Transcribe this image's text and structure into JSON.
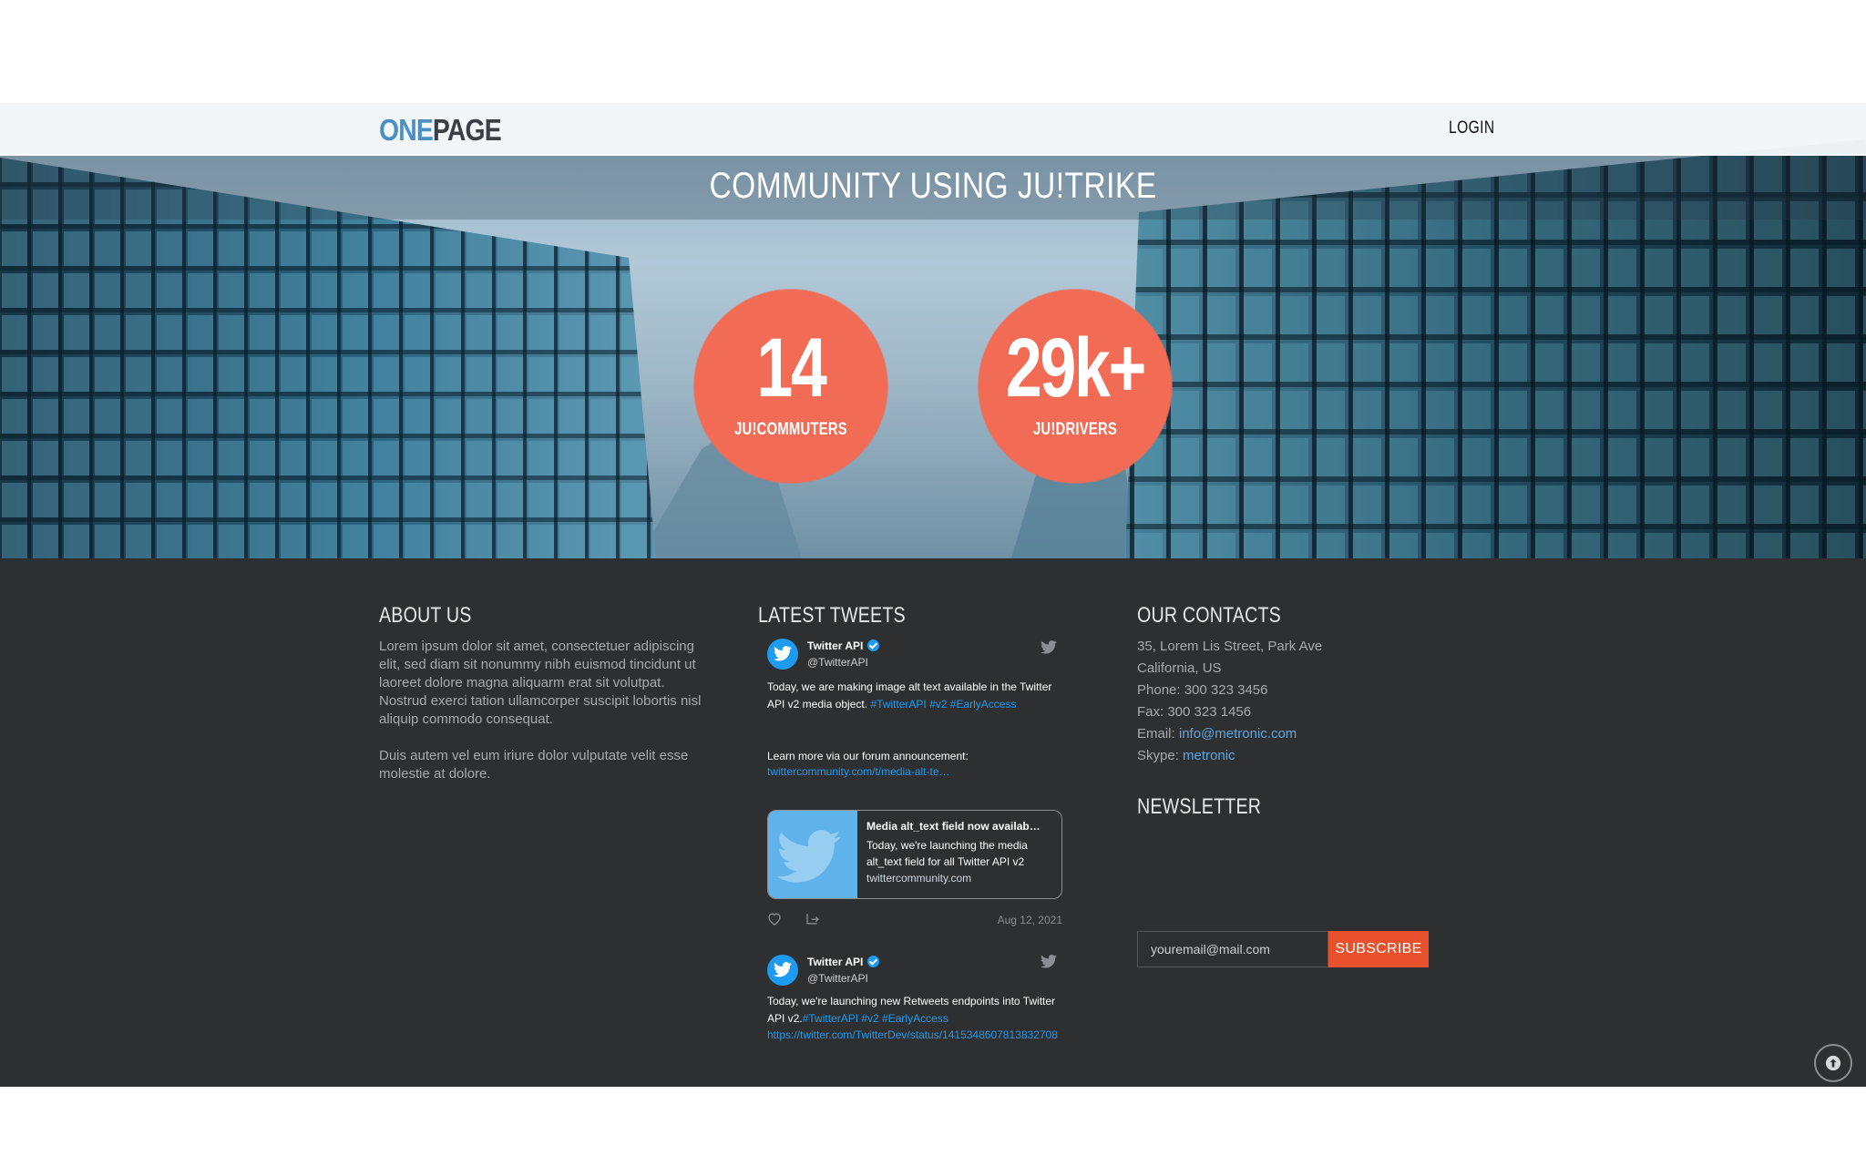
{
  "header": {
    "logo_part1": "ONE",
    "logo_part2": "PAGE",
    "login_label": "LOGIN"
  },
  "hero": {
    "title": "COMMUNITY USING JU!TRIKE",
    "stats": [
      {
        "value": "14",
        "label": "JU!COMMUTERS"
      },
      {
        "value": "29k+",
        "label": "JU!DRIVERS"
      }
    ],
    "accent_color": "#f26b55"
  },
  "about": {
    "title": "ABOUT US",
    "paragraphs": [
      "Lorem ipsum dolor sit amet, consectetuer adipiscing elit, sed diam sit nonummy nibh euismod tincidunt ut laoreet dolore magna aliquarm erat sit volutpat. Nostrud exerci tation ullamcorper suscipit lobortis nisl aliquip commodo consequat.",
      "Duis autem vel eum iriure dolor vulputate velit esse molestie at dolore."
    ]
  },
  "tweets": {
    "title": "LATEST TWEETS",
    "items": [
      {
        "name": "Twitter API",
        "handle": "@TwitterAPI",
        "text": "Today, we are making image alt text available in the Twitter API v2 media object.",
        "tags": "#TwitterAPI #v2 #EarlyAccess",
        "extra": "Learn more via our forum announcement:",
        "link": "twittercommunity.com/t/media-alt-te…",
        "card_title": "Media alt_text field now availab…",
        "card_desc": "Today, we're launching the media alt_text field for all Twitter API v2",
        "card_url": "twittercommunity.com",
        "date": "Aug 12, 2021"
      },
      {
        "name": "Twitter API",
        "handle": "@TwitterAPI",
        "text": "Today, we're launching new Retweets endpoints into Twitter API v2.",
        "tags": "#TwitterAPI #v2 #EarlyAccess",
        "link": "https://twitter.com/TwitterDev/status/1415348607813832708"
      }
    ]
  },
  "contacts": {
    "title": "OUR CONTACTS",
    "address1": "35, Lorem Lis Street, Park Ave",
    "address2": "California, US",
    "phone": "Phone: 300 323 3456",
    "fax": "Fax: 300 323 1456",
    "email_label": "Email:",
    "email": "info@metronic.com",
    "skype_label": "Skype:",
    "skype": "metronic"
  },
  "newsletter": {
    "title": "NEWSLETTER",
    "placeholder": "youremail@mail.com",
    "button_label": "SUBSCRIBE"
  },
  "icons": {
    "scroll_top": "arrow-up-icon",
    "twitter": "twitter-bird-icon",
    "like": "heart-icon",
    "share": "share-icon"
  }
}
